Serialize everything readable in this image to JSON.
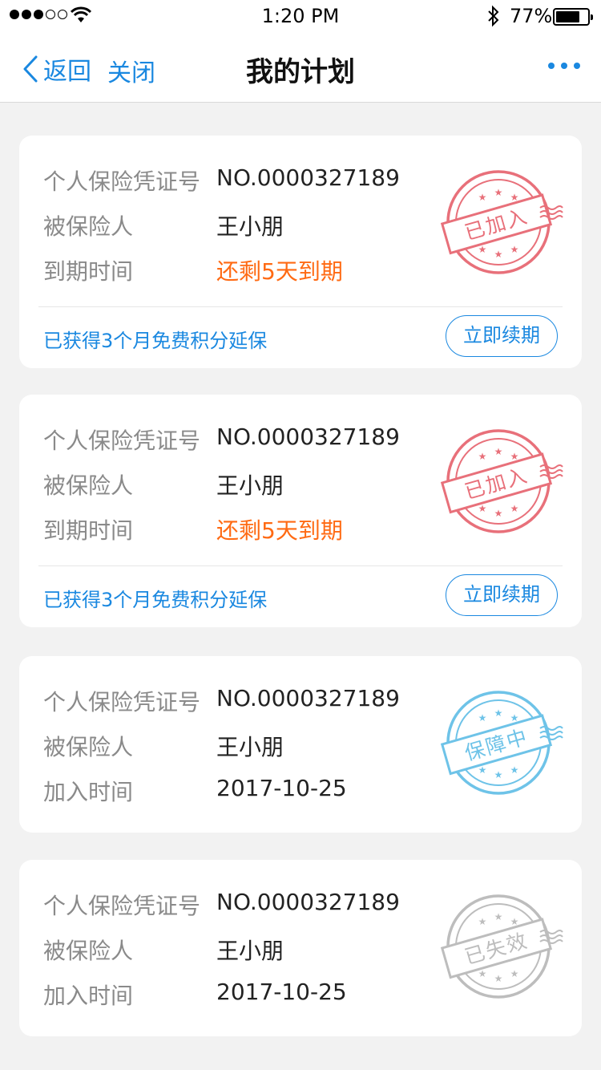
{
  "status_bar": {
    "time": "1:20 PM",
    "battery_text": "77%",
    "battery_level": 0.77,
    "signal_bars": 5,
    "signal_filled": 3
  },
  "nav": {
    "back_label": "返回",
    "close_label": "关闭",
    "title": "我的计划",
    "accent_color": "#1a88e0"
  },
  "plans": [
    {
      "cert_label": "个人保险凭证号",
      "cert_no": "NO.0000327189",
      "insured_label": "被保险人",
      "insured_name": "王小朋",
      "date_label": "到期时间",
      "date_value": "还剩5天到期",
      "date_is_warning": true,
      "promo": "已获得3个月免费积分延保",
      "button_label": "立即续期",
      "stamp_text": "已加入",
      "stamp_color": "#e8707a"
    },
    {
      "cert_label": "个人保险凭证号",
      "cert_no": "NO.0000327189",
      "insured_label": "被保险人",
      "insured_name": "王小朋",
      "date_label": "到期时间",
      "date_value": "还剩5天到期",
      "date_is_warning": true,
      "promo": "已获得3个月免费积分延保",
      "button_label": "立即续期",
      "stamp_text": "已加入",
      "stamp_color": "#e8707a"
    },
    {
      "cert_label": "个人保险凭证号",
      "cert_no": "NO.0000327189",
      "insured_label": "被保险人",
      "insured_name": "王小朋",
      "date_label": "加入时间",
      "date_value": "2017-10-25",
      "date_is_warning": false,
      "stamp_text": "保障中",
      "stamp_color": "#6ec3e8"
    },
    {
      "cert_label": "个人保险凭证号",
      "cert_no": "NO.0000327189",
      "insured_label": "被保险人",
      "insured_name": "王小朋",
      "date_label": "加入时间",
      "date_value": "2017-10-25",
      "date_is_warning": false,
      "stamp_text": "已失效",
      "stamp_color": "#bdbdbd"
    }
  ]
}
